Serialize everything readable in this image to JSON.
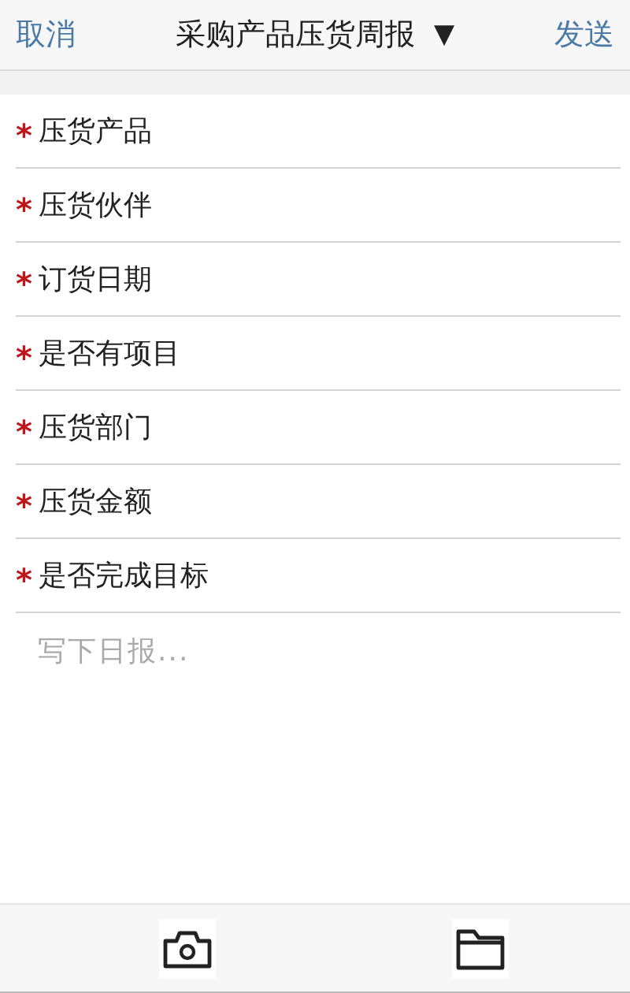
{
  "header": {
    "cancel": "取消",
    "title": "采购产品压货周报",
    "caret": "▼",
    "send": "发送"
  },
  "fields": [
    {
      "mark": "*",
      "label": "压货产品"
    },
    {
      "mark": "*",
      "label": "压货伙伴"
    },
    {
      "mark": "*",
      "label": "订货日期"
    },
    {
      "mark": "*",
      "label": "是否有项目"
    },
    {
      "mark": "*",
      "label": "压货部门"
    },
    {
      "mark": "*",
      "label": "压货金额"
    },
    {
      "mark": "*",
      "label": "是否完成目标"
    }
  ],
  "report": {
    "placeholder": "写下日报..."
  }
}
